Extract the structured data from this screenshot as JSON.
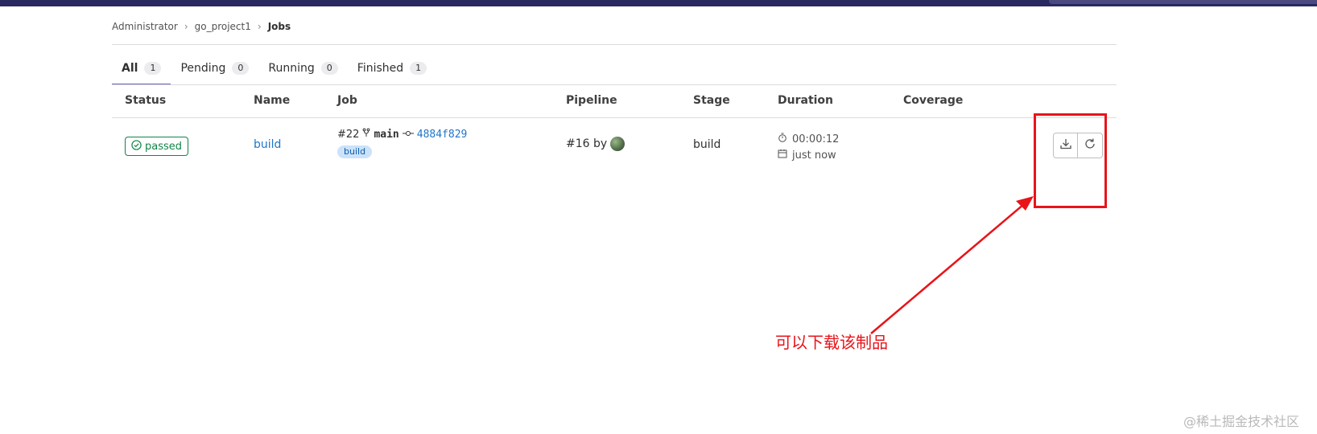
{
  "breadcrumb": {
    "items": [
      "Administrator",
      "go_project1"
    ],
    "current": "Jobs",
    "separator": "›"
  },
  "tabs": [
    {
      "label": "All",
      "count": "1",
      "active": true
    },
    {
      "label": "Pending",
      "count": "0"
    },
    {
      "label": "Running",
      "count": "0"
    },
    {
      "label": "Finished",
      "count": "1"
    }
  ],
  "table": {
    "headers": {
      "status": "Status",
      "name": "Name",
      "job": "Job",
      "pipeline": "Pipeline",
      "stage": "Stage",
      "duration": "Duration",
      "coverage": "Coverage"
    },
    "rows": [
      {
        "status": "passed",
        "name": "build",
        "job_id": "#22",
        "branch": "main",
        "commit": "4884f829",
        "tag": "build",
        "pipeline": "#16 by",
        "stage": "build",
        "duration": "00:00:12",
        "finished": "just now"
      }
    ]
  },
  "icons": {
    "status": "check-circle-icon",
    "branch": "branch-icon",
    "commit": "commit-icon",
    "timer": "timer-icon",
    "calendar": "calendar-icon",
    "download": "download-icon",
    "retry": "retry-icon"
  },
  "colors": {
    "topbar": "#292961",
    "passed": "#108548",
    "link": "#1f75cb",
    "annotation": "#e8141a"
  },
  "annotation": {
    "text": "可以下载该制品"
  },
  "watermark": "@稀土掘金技术社区"
}
